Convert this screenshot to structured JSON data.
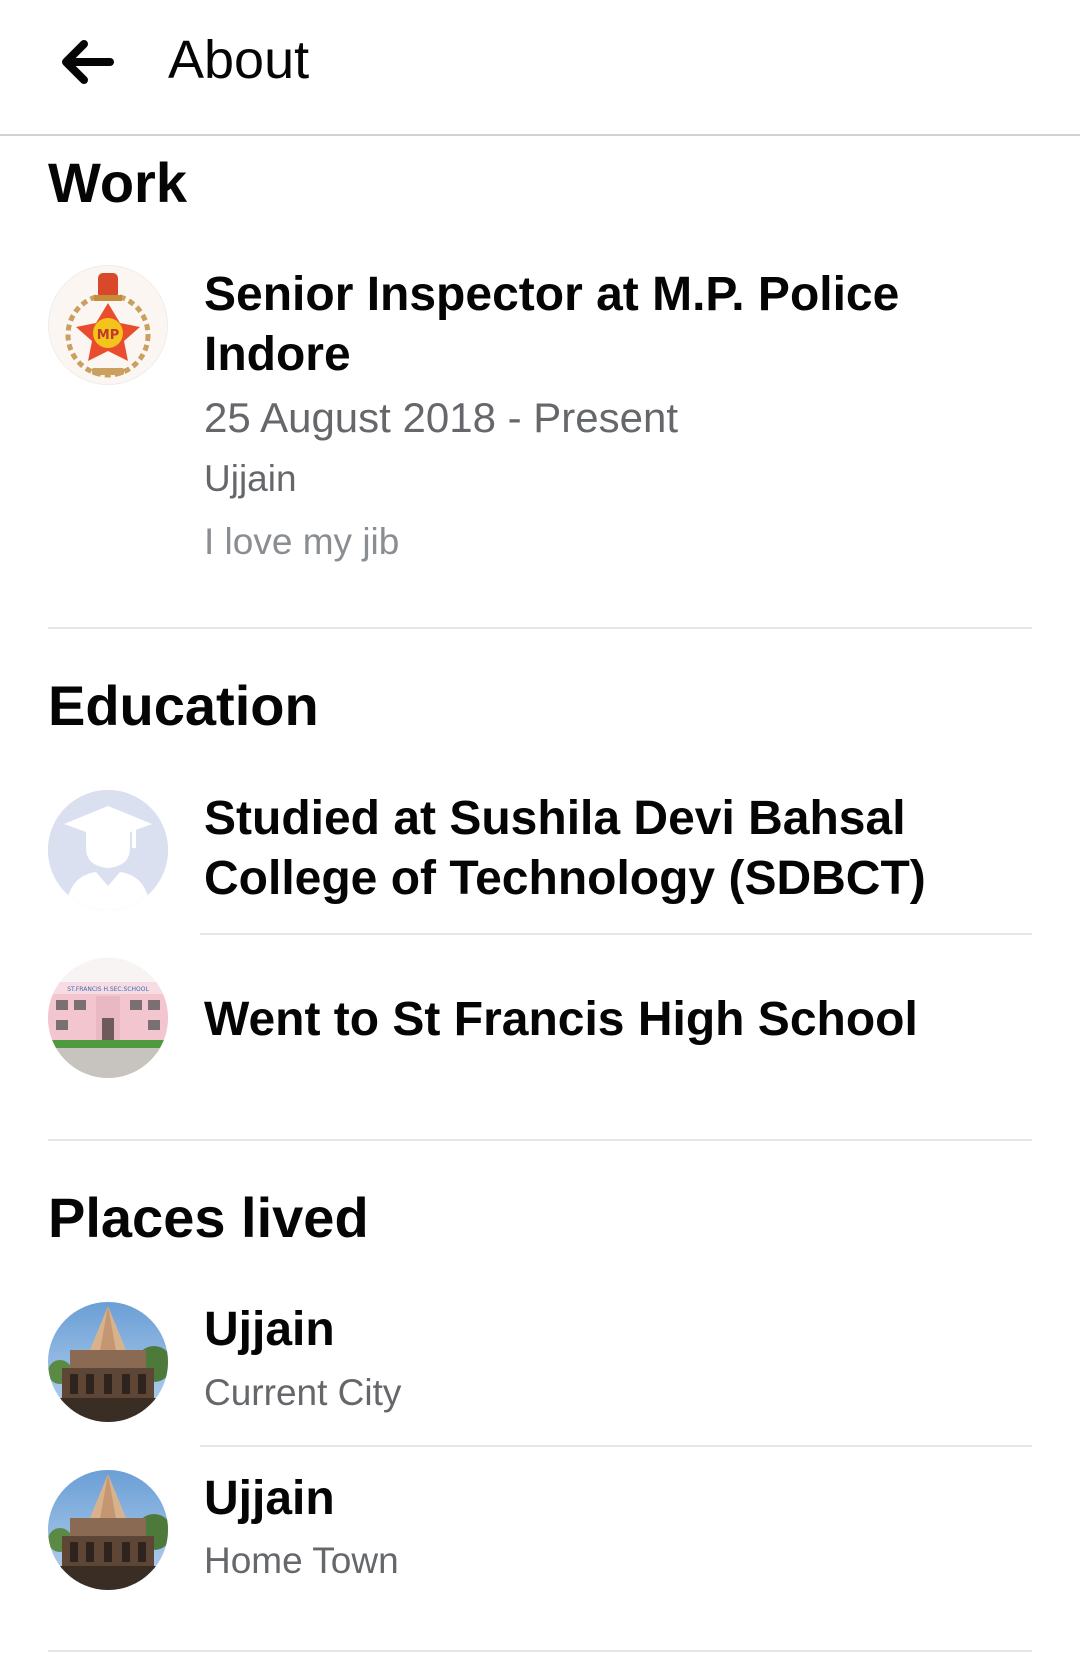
{
  "header": {
    "back_icon": "arrow-left-icon",
    "title": "About"
  },
  "work": {
    "heading": "Work",
    "item": {
      "icon": "police-emblem-icon",
      "title_line1": "Senior Inspector at M.P. Police",
      "title_line2": "Indore",
      "dates": "25 August 2018 - Present",
      "location": "Ujjain",
      "description": "I love my jib"
    }
  },
  "education": {
    "heading": "Education",
    "items": [
      {
        "icon": "graduation-cap-icon",
        "title_line1": "Studied at Sushila Devi Bahsal",
        "title_line2": "College of Technology (SDBCT)"
      },
      {
        "icon": "school-building-icon",
        "title": "Went to St Francis High School",
        "image_caption": "ST.FRANCIS H.SEC.SCHOOL"
      }
    ]
  },
  "places": {
    "heading": "Places lived",
    "items": [
      {
        "icon": "temple-icon",
        "city": "Ujjain",
        "type": "Current City"
      },
      {
        "icon": "temple-icon",
        "city": "Ujjain",
        "type": "Home Town"
      }
    ]
  }
}
